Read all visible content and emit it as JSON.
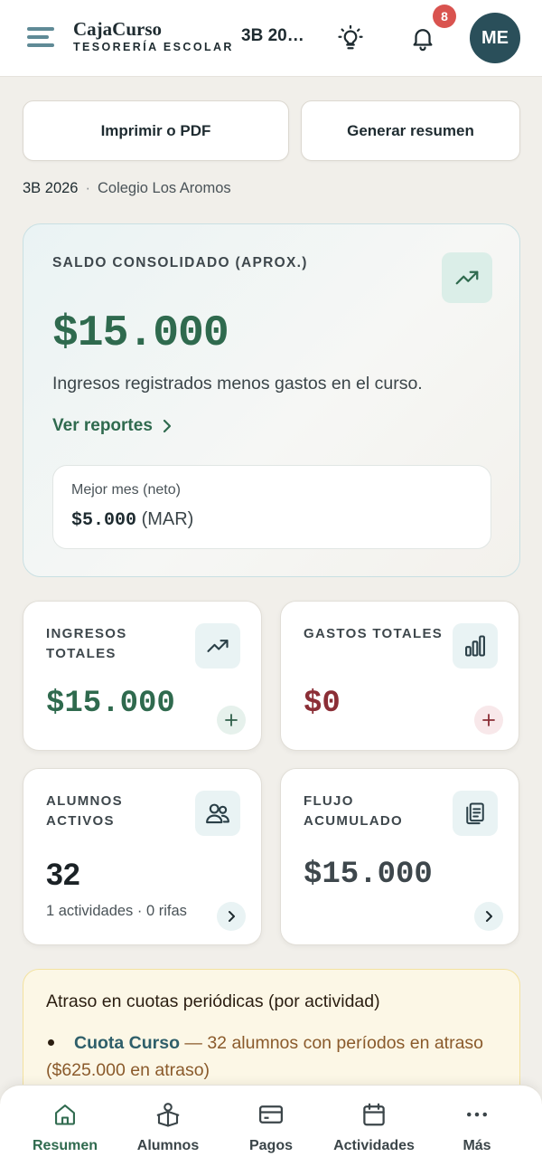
{
  "header": {
    "brand_name": "CajaCurso",
    "brand_sub": "TESORERÍA ESCOLAR",
    "course": "3B 20…",
    "notifications_count": "8",
    "avatar_initials": "ME"
  },
  "actions": {
    "print": "Imprimir o PDF",
    "summary": "Generar resumen"
  },
  "breadcrumb": {
    "course": "3B 2026",
    "separator": "·",
    "school": "Colegio Los Aromos"
  },
  "saldo": {
    "label": "SALDO CONSOLIDADO (APROX.)",
    "value": "$15.000",
    "description": "Ingresos registrados menos gastos en el curso.",
    "link": "Ver reportes",
    "best_label": "Mejor mes (neto)",
    "best_amount": "$5.000",
    "best_month": "(MAR)"
  },
  "cards": {
    "ingresos": {
      "label": "INGRESOS TOTALES",
      "value": "$15.000",
      "icon": "trending-up-icon"
    },
    "gastos": {
      "label": "GASTOS TOTALES",
      "value": "$0",
      "icon": "bar-chart-icon"
    },
    "alumnos": {
      "label": "ALUMNOS ACTIVOS",
      "value": "32",
      "sub": "1 actividades · 0 rifas",
      "icon": "users-icon"
    },
    "flujo": {
      "label": "FLUJO ACUMULADO",
      "value": "$15.000",
      "icon": "clipboard-icon"
    }
  },
  "alert": {
    "title": "Atraso en cuotas periódicas (por actividad)",
    "item_name": "Cuota Curso",
    "item_text": " — 32 alumnos con períodos en atraso ($625.000 en atraso)"
  },
  "nav": {
    "items": [
      {
        "label": "Resumen",
        "icon": "home-icon",
        "active": true
      },
      {
        "label": "Alumnos",
        "icon": "students-icon"
      },
      {
        "label": "Pagos",
        "icon": "credit-card-icon"
      },
      {
        "label": "Actividades",
        "icon": "calendar-icon"
      },
      {
        "label": "Más",
        "icon": "more-icon"
      }
    ]
  },
  "colors": {
    "accent_green": "#2f6a4e",
    "expense_red": "#8b2e36",
    "avatar_bg": "#2a4f5a",
    "badge_red": "#d9534f"
  }
}
